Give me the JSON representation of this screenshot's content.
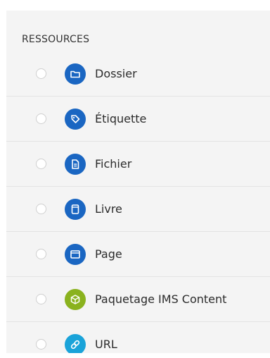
{
  "section": {
    "heading": "RESSOURCES"
  },
  "colors": {
    "panel_bg": "#f4f4f4",
    "icon_blue": "#1a66c2",
    "icon_green": "#8ab21e",
    "icon_cyan": "#1aa3d9"
  },
  "items": [
    {
      "label": "Dossier",
      "icon": "folder-icon",
      "color": "#1a66c2"
    },
    {
      "label": "Étiquette",
      "icon": "tag-icon",
      "color": "#1a66c2"
    },
    {
      "label": "Fichier",
      "icon": "file-icon",
      "color": "#1a66c2"
    },
    {
      "label": "Livre",
      "icon": "book-icon",
      "color": "#1a66c2"
    },
    {
      "label": "Page",
      "icon": "page-icon",
      "color": "#1a66c2"
    },
    {
      "label": "Paquetage IMS Content",
      "icon": "package-cube-icon",
      "color": "#8ab21e"
    },
    {
      "label": "URL",
      "icon": "link-icon",
      "color": "#1aa3d9"
    }
  ]
}
